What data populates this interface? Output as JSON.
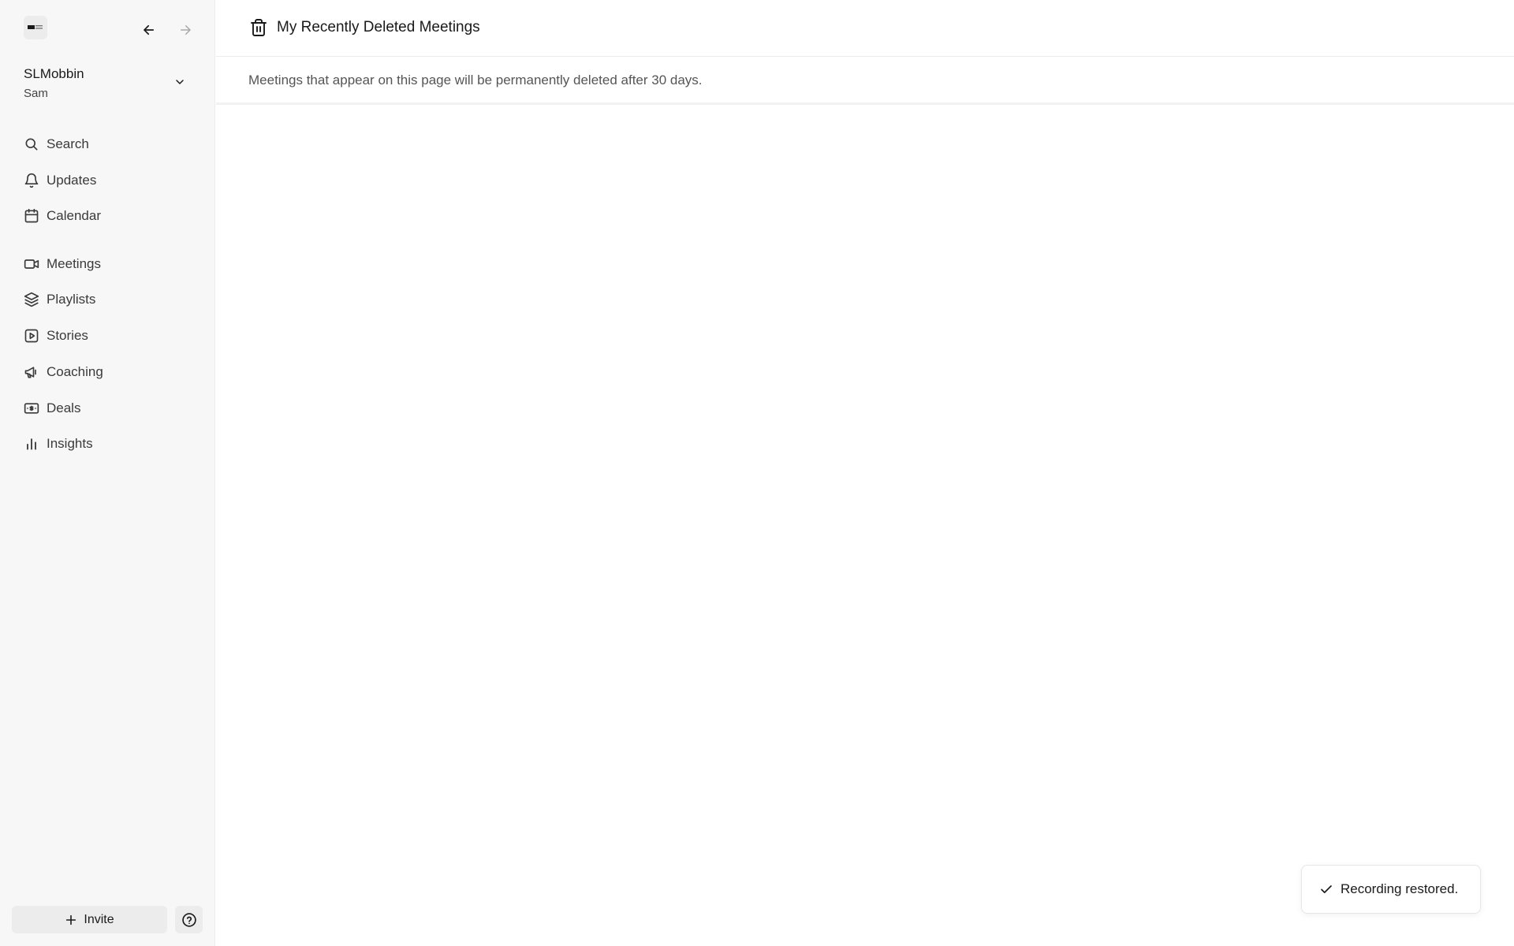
{
  "workspace": {
    "name": "SLMobbin",
    "user": "Sam"
  },
  "sidebar": {
    "items": [
      {
        "label": "Search",
        "icon": "search-icon"
      },
      {
        "label": "Updates",
        "icon": "bell-icon"
      },
      {
        "label": "Calendar",
        "icon": "calendar-icon"
      },
      {
        "label": "Meetings",
        "icon": "video-icon"
      },
      {
        "label": "Playlists",
        "icon": "layers-icon"
      },
      {
        "label": "Stories",
        "icon": "play-square-icon"
      },
      {
        "label": "Coaching",
        "icon": "megaphone-icon"
      },
      {
        "label": "Deals",
        "icon": "money-icon"
      },
      {
        "label": "Insights",
        "icon": "bar-chart-icon"
      }
    ],
    "invite_label": "Invite"
  },
  "header": {
    "title": "My Recently Deleted Meetings",
    "icon": "trash-icon"
  },
  "notice": {
    "text": "Meetings that appear on this page will be permanently deleted after 30 days."
  },
  "toast": {
    "text": "Recording restored.",
    "icon": "check-icon"
  }
}
